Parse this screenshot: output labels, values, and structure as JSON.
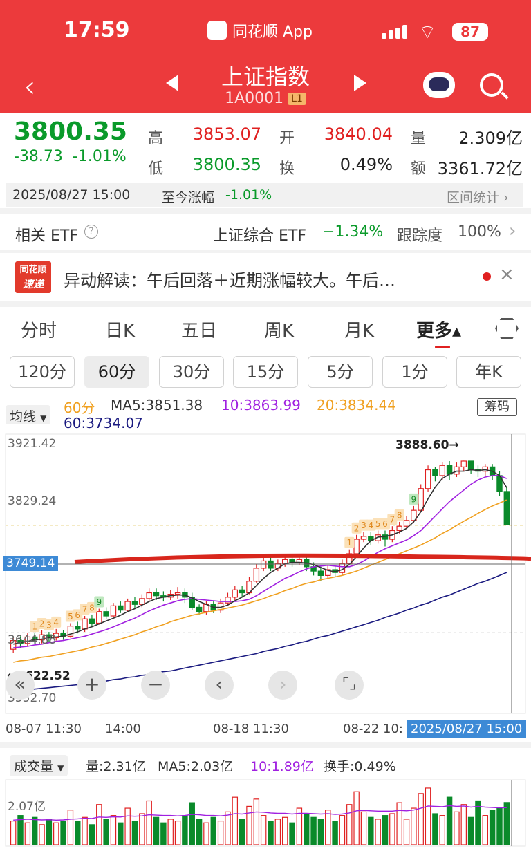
{
  "status": {
    "time": "17:59",
    "app_name": "同花顺 App",
    "battery": "87"
  },
  "header": {
    "title": "上证指数",
    "code": "1A0001",
    "badge": "L1"
  },
  "quote": {
    "price": "3800.35",
    "change": "-38.73",
    "change_pct": "-1.01%",
    "high_label": "高",
    "high": "3853.07",
    "open_label": "开",
    "open": "3840.04",
    "vol_label": "量",
    "volume": "2.309亿",
    "low_label": "低",
    "low": "3800.35",
    "turnover_label": "换",
    "turnover": "0.49%",
    "amount_label": "额",
    "amount": "3361.72亿"
  },
  "timebar": {
    "datetime": "2025/08/27 15:00",
    "since_label": "至今涨幅",
    "since_value": "-1.01%",
    "range_stats": "区间统计"
  },
  "etf": {
    "label": "相关 ETF",
    "name": "上证综合 ETF",
    "change": "−1.34%",
    "track_label": "跟踪度",
    "track_value": "100%"
  },
  "news": {
    "logo_top": "同花顺",
    "logo_bottom": "速递",
    "text": "异动解读：午后回落＋近期涨幅较大。午后…"
  },
  "tabs": [
    "分时",
    "日K",
    "五日",
    "周K",
    "月K",
    "更多▴"
  ],
  "periods": [
    "120分",
    "60分",
    "30分",
    "15分",
    "5分",
    "1分",
    "年K"
  ],
  "ma": {
    "selector": "均线",
    "period": "60分",
    "ma5": "MA5:3851.38",
    "ma10": "10:3863.99",
    "ma20": "20:3834.44",
    "ma60": "60:3734.07",
    "chips": "筹码"
  },
  "axis": {
    "y_ticks": [
      "3921.42",
      "3829.24",
      "3644.88",
      "3552.70"
    ],
    "marker": "3749.14",
    "high_note": "3888.60→",
    "low_note": "←3622.52",
    "x_ticks": [
      "08-07 11:30",
      "14:00",
      "08-18 11:30",
      "08-22 10:"
    ],
    "cursor_time": "2025/08/27 15:00"
  },
  "volume_panel": {
    "selector": "成交量",
    "vol": "量:2.31亿",
    "ma5": "MA5:2.03亿",
    "ma10": "10:1.89亿",
    "turnover": "换手:0.49%",
    "y_tick": "2.07亿"
  },
  "colors": {
    "up": "#e02020",
    "down": "#0a8a2a",
    "ma5": "#333333",
    "ma10": "#a020e0",
    "ma20": "#f0a020",
    "ma60": "#1a1a80",
    "header": "#ec3a3c"
  },
  "chart_data": {
    "type": "candlestick",
    "y_range": [
      3552.7,
      3921.42
    ],
    "candles": [
      [
        3628,
        3640,
        3622.52,
        3645
      ],
      [
        3640,
        3636,
        3630,
        3646
      ],
      [
        3636,
        3645,
        3632,
        3650
      ],
      [
        3645,
        3641,
        3635,
        3650
      ],
      [
        3641,
        3648,
        3636,
        3654
      ],
      [
        3648,
        3644,
        3638,
        3652
      ],
      [
        3644,
        3650,
        3640,
        3656
      ],
      [
        3650,
        3646,
        3641,
        3654
      ],
      [
        3646,
        3660,
        3644,
        3664
      ],
      [
        3660,
        3656,
        3650,
        3666
      ],
      [
        3656,
        3670,
        3652,
        3674
      ],
      [
        3670,
        3664,
        3660,
        3676
      ],
      [
        3664,
        3680,
        3662,
        3684
      ],
      [
        3680,
        3674,
        3670,
        3686
      ],
      [
        3674,
        3688,
        3672,
        3692
      ],
      [
        3688,
        3682,
        3678,
        3694
      ],
      [
        3682,
        3694,
        3680,
        3698
      ],
      [
        3694,
        3690,
        3684,
        3700
      ],
      [
        3690,
        3698,
        3686,
        3704
      ],
      [
        3698,
        3706,
        3694,
        3712
      ],
      [
        3706,
        3702,
        3696,
        3712
      ],
      [
        3702,
        3700,
        3694,
        3708
      ],
      [
        3700,
        3704,
        3696,
        3710
      ],
      [
        3704,
        3706,
        3698,
        3714
      ],
      [
        3706,
        3700,
        3692,
        3712
      ],
      [
        3700,
        3686,
        3682,
        3706
      ],
      [
        3686,
        3680,
        3676,
        3690
      ],
      [
        3680,
        3690,
        3676,
        3694
      ],
      [
        3690,
        3682,
        3678,
        3694
      ],
      [
        3682,
        3692,
        3678,
        3698
      ],
      [
        3692,
        3700,
        3688,
        3706
      ],
      [
        3700,
        3710,
        3696,
        3716
      ],
      [
        3710,
        3706,
        3700,
        3716
      ],
      [
        3706,
        3722,
        3704,
        3728
      ],
      [
        3722,
        3740,
        3720,
        3746
      ],
      [
        3740,
        3750,
        3736,
        3756
      ],
      [
        3750,
        3740,
        3736,
        3756
      ],
      [
        3740,
        3746,
        3736,
        3752
      ],
      [
        3746,
        3752,
        3742,
        3758
      ],
      [
        3752,
        3748,
        3742,
        3758
      ],
      [
        3748,
        3752,
        3744,
        3760
      ],
      [
        3752,
        3742,
        3736,
        3756
      ],
      [
        3742,
        3736,
        3730,
        3748
      ],
      [
        3736,
        3730,
        3722,
        3742
      ],
      [
        3730,
        3738,
        3726,
        3744
      ],
      [
        3738,
        3734,
        3728,
        3744
      ],
      [
        3734,
        3746,
        3730,
        3752
      ],
      [
        3746,
        3760,
        3744,
        3766
      ],
      [
        3760,
        3780,
        3758,
        3786
      ],
      [
        3780,
        3784,
        3776,
        3790
      ],
      [
        3784,
        3778,
        3772,
        3790
      ],
      [
        3778,
        3786,
        3774,
        3792
      ],
      [
        3786,
        3780,
        3770,
        3792
      ],
      [
        3780,
        3792,
        3776,
        3798
      ],
      [
        3792,
        3798,
        3788,
        3804
      ],
      [
        3798,
        3806,
        3794,
        3812
      ],
      [
        3806,
        3820,
        3802,
        3826
      ],
      [
        3820,
        3850,
        3818,
        3856
      ],
      [
        3850,
        3876,
        3846,
        3882
      ],
      [
        3876,
        3868,
        3860,
        3880
      ],
      [
        3868,
        3882,
        3862,
        3886
      ],
      [
        3882,
        3870,
        3862,
        3888
      ],
      [
        3870,
        3880,
        3866,
        3886
      ],
      [
        3880,
        3888,
        3874,
        3888.6
      ],
      [
        3888,
        3876,
        3870,
        3888
      ],
      [
        3876,
        3874,
        3866,
        3882
      ],
      [
        3874,
        3880,
        3868,
        3884
      ],
      [
        3880,
        3868,
        3862,
        3884
      ],
      [
        3868,
        3846,
        3840,
        3874
      ],
      [
        3846,
        3800.35,
        3800.35,
        3853.07
      ]
    ],
    "ma5": [
      3635,
      3637,
      3639,
      3641,
      3642,
      3644,
      3645,
      3646,
      3649,
      3652,
      3656,
      3659,
      3663,
      3667,
      3671,
      3675,
      3680,
      3684,
      3689,
      3694,
      3698,
      3700,
      3702,
      3703,
      3703,
      3699,
      3694,
      3690,
      3686,
      3686,
      3689,
      3695,
      3700,
      3706,
      3716,
      3726,
      3734,
      3740,
      3746,
      3748,
      3748,
      3747,
      3745,
      3741,
      3737,
      3735,
      3738,
      3745,
      3756,
      3768,
      3778,
      3783,
      3784,
      3786,
      3790,
      3795,
      3804,
      3818,
      3836,
      3852,
      3864,
      3870,
      3874,
      3874,
      3876,
      3875,
      3876,
      3874,
      3868,
      3851.38
    ],
    "ma10": [
      3630,
      3631,
      3632,
      3634,
      3635,
      3637,
      3639,
      3640,
      3642,
      3644,
      3646,
      3649,
      3652,
      3655,
      3659,
      3663,
      3667,
      3671,
      3676,
      3681,
      3685,
      3689,
      3692,
      3695,
      3697,
      3698,
      3697,
      3696,
      3695,
      3694,
      3694,
      3694,
      3695,
      3697,
      3702,
      3708,
      3714,
      3720,
      3726,
      3730,
      3735,
      3739,
      3742,
      3743,
      3744,
      3743,
      3742,
      3742,
      3745,
      3750,
      3756,
      3762,
      3767,
      3771,
      3775,
      3779,
      3785,
      3792,
      3802,
      3812,
      3822,
      3832,
      3840,
      3848,
      3856,
      3862,
      3866,
      3868,
      3868,
      3863.99
    ],
    "ma20": [
      3610,
      3612,
      3613,
      3615,
      3617,
      3618,
      3620,
      3622,
      3624,
      3626,
      3628,
      3631,
      3633,
      3636,
      3639,
      3642,
      3645,
      3648,
      3652,
      3655,
      3659,
      3662,
      3666,
      3669,
      3672,
      3675,
      3677,
      3679,
      3681,
      3683,
      3685,
      3687,
      3689,
      3692,
      3695,
      3698,
      3702,
      3705,
      3709,
      3712,
      3716,
      3719,
      3721,
      3724,
      3726,
      3728,
      3730,
      3733,
      3736,
      3740,
      3744,
      3748,
      3752,
      3756,
      3760,
      3764,
      3768,
      3772,
      3777,
      3782,
      3788,
      3793,
      3799,
      3805,
      3810,
      3816,
      3821,
      3826,
      3830,
      3834.44
    ],
    "ma60": [
      3570,
      3571,
      3572,
      3573,
      3574,
      3575,
      3576,
      3577,
      3578,
      3579,
      3581,
      3582,
      3583,
      3584,
      3586,
      3587,
      3589,
      3590,
      3592,
      3593,
      3595,
      3597,
      3598,
      3600,
      3602,
      3604,
      3606,
      3608,
      3610,
      3612,
      3614,
      3616,
      3618,
      3620,
      3622,
      3625,
      3627,
      3629,
      3632,
      3634,
      3637,
      3639,
      3642,
      3645,
      3647,
      3650,
      3653,
      3656,
      3659,
      3662,
      3665,
      3668,
      3672,
      3675,
      3678,
      3682,
      3685,
      3689,
      3692,
      3696,
      3700,
      3703,
      3707,
      3711,
      3715,
      3719,
      3722,
      3726,
      3730,
      3734.07
    ],
    "td_marks": [
      {
        "i": 3,
        "n": "1"
      },
      {
        "i": 4,
        "n": "2"
      },
      {
        "i": 5,
        "n": "3"
      },
      {
        "i": 6,
        "n": "4"
      },
      {
        "i": 8,
        "n": "5"
      },
      {
        "i": 9,
        "n": "6"
      },
      {
        "i": 10,
        "n": "7"
      },
      {
        "i": 11,
        "n": "8"
      },
      {
        "i": 12,
        "n": "9"
      },
      {
        "i": 47,
        "n": "1"
      },
      {
        "i": 48,
        "n": "2"
      },
      {
        "i": 49,
        "n": "3"
      },
      {
        "i": 50,
        "n": "4"
      },
      {
        "i": 51,
        "n": "5"
      },
      {
        "i": 52,
        "n": "6"
      },
      {
        "i": 53,
        "n": "7"
      },
      {
        "i": 54,
        "n": "8"
      },
      {
        "i": 56,
        "n": "9"
      }
    ],
    "volumes": [
      1.3,
      1.6,
      1.2,
      1.5,
      1.1,
      1.4,
      1.2,
      1.3,
      1.9,
      1.3,
      1.5,
      1.1,
      2.2,
      1.4,
      1.6,
      1.2,
      2.0,
      1.3,
      1.7,
      2.4,
      1.5,
      1.2,
      1.4,
      1.3,
      1.6,
      2.3,
      1.4,
      1.2,
      1.5,
      1.3,
      1.8,
      2.6,
      1.4,
      2.1,
      2.5,
      1.6,
      1.3,
      1.4,
      1.5,
      1.2,
      2.0,
      1.7,
      1.5,
      1.4,
      1.9,
      1.3,
      1.6,
      2.2,
      2.9,
      1.8,
      1.5,
      1.4,
      1.6,
      1.7,
      2.3,
      1.4,
      2.0,
      2.8,
      3.1,
      1.7,
      1.6,
      2.6,
      1.8,
      2.2,
      1.5,
      2.4,
      1.6,
      1.9,
      2.0,
      2.31
    ],
    "volume_ma": [
      1.35,
      1.38,
      1.4,
      1.38,
      1.36,
      1.37,
      1.35,
      1.36,
      1.4,
      1.42,
      1.45,
      1.44,
      1.52,
      1.5,
      1.53,
      1.52,
      1.58,
      1.56,
      1.58,
      1.64,
      1.62,
      1.6,
      1.6,
      1.58,
      1.6,
      1.66,
      1.64,
      1.6,
      1.6,
      1.58,
      1.62,
      1.7,
      1.68,
      1.74,
      1.8,
      1.78,
      1.74,
      1.72,
      1.72,
      1.68,
      1.72,
      1.72,
      1.7,
      1.68,
      1.7,
      1.66,
      1.68,
      1.74,
      1.86,
      1.88,
      1.86,
      1.84,
      1.84,
      1.84,
      1.88,
      1.86,
      1.9,
      2.0,
      2.12,
      2.1,
      2.08,
      2.14,
      2.1,
      2.12,
      2.06,
      2.1,
      2.06,
      2.04,
      2.02,
      2.03
    ]
  }
}
